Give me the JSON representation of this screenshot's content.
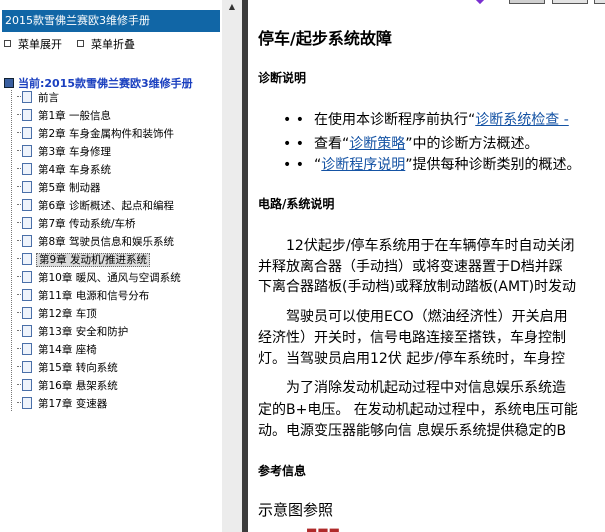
{
  "tree": {
    "title": "2015款雪佛兰赛欧3维修手册",
    "expand_label": "菜单展开",
    "collapse_label": "菜单折叠",
    "root_label": "当前:2015款雪佛兰赛欧3维修手册",
    "items": [
      {
        "label": "前言"
      },
      {
        "label": "第1章 一般信息"
      },
      {
        "label": "第2章 车身金属构件和装饰件"
      },
      {
        "label": "第3章 车身修理"
      },
      {
        "label": "第4章 车身系统"
      },
      {
        "label": "第5章 制动器"
      },
      {
        "label": "第6章 诊断概述、起点和编程"
      },
      {
        "label": "第7章 传动系统/车桥"
      },
      {
        "label": "第8章 驾驶员信息和娱乐系统"
      },
      {
        "label": "第9章 发动机/推进系统",
        "selected": true
      },
      {
        "label": "第10章 暖风、通风与空调系统"
      },
      {
        "label": "第11章 电源和信号分布"
      },
      {
        "label": "第12章 车顶"
      },
      {
        "label": "第13章 安全和防护"
      },
      {
        "label": "第14章 座椅"
      },
      {
        "label": "第15章 转向系统"
      },
      {
        "label": "第16章 悬架系统"
      },
      {
        "label": "第17章 变速器"
      }
    ]
  },
  "content": {
    "title": "停车/起步系统故障",
    "diag_heading": "诊断说明",
    "bullets": [
      {
        "pre": "在使用本诊断程序前执行“",
        "link": "诊断系统检查 -",
        "post": ""
      },
      {
        "pre": "查看“",
        "link": "诊断策略",
        "post": "”中的诊断方法概述。"
      },
      {
        "pre": "“",
        "link": "诊断程序说明",
        "post": "”提供每种诊断类别的概述。"
      }
    ],
    "circuit_heading": "电路/系统说明",
    "para1": [
      "　　12伏起步/停车系统用于在车辆停车时自动关闭",
      "并释放离合器（手动挡）或将变速器置于D档并踩",
      "下离合器踏板(手动档)或释放制动踏板(AMT)时发动"
    ],
    "para2": [
      "　　驾驶员可以使用ECO（燃油经济性）开关启用",
      "经济性）开关时，信号电路连接至搭铁，车身控制",
      "灯。当驾驶员启用12伏 起步/停车系统时，车身控"
    ],
    "para3": [
      "　　为了消除发动机起动过程中对信息娱乐系统造",
      "定的B+电压。 在发动机起动过程中，系统电压可能",
      "动。电源变压器能够向信 息娱乐系统提供稳定的B"
    ],
    "ref_heading": "参考信息",
    "diagram_ref": "示意图参照",
    "bullet_glyph": "•  •"
  }
}
